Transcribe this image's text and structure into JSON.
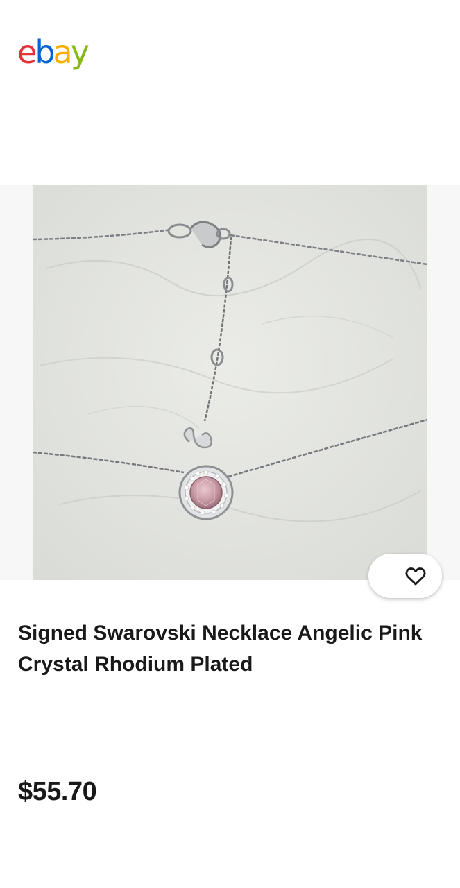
{
  "header": {
    "logo": {
      "letters": [
        "e",
        "b",
        "a",
        "y"
      ],
      "colors": [
        "#e53238",
        "#0064d2",
        "#f5af02",
        "#86b817"
      ]
    }
  },
  "listing": {
    "image_description_icon": "product-photo",
    "watch_icon": "heart-icon",
    "title": "Signed Swarovski Necklace Angelic Pink Crystal Rhodium Plated",
    "price": "$55.70"
  }
}
